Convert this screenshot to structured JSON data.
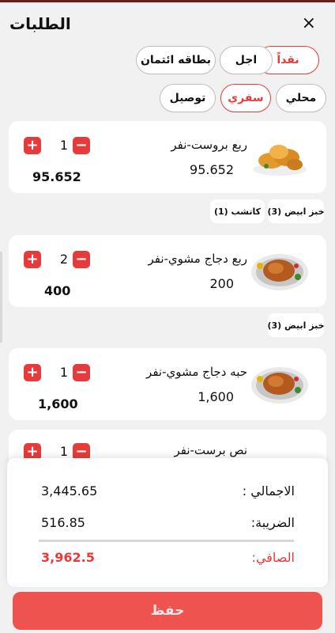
{
  "header": {
    "title": "الطلبات",
    "close_icon": "×"
  },
  "payment_options": [
    {
      "label": "نقداً",
      "active": true
    },
    {
      "label": "اجل",
      "active": false
    },
    {
      "label": "بطاقه ائتمان",
      "active": false
    }
  ],
  "order_types": [
    {
      "label": "محلي",
      "active": false
    },
    {
      "label": "سفري",
      "active": true
    },
    {
      "label": "توصيل",
      "active": false
    }
  ],
  "items": [
    {
      "name": "ربع بروست-نفر",
      "price": "95.652",
      "qty": "1",
      "total": "95.652",
      "image": "broasted-chicken"
    },
    {
      "name": "ربع دجاج مشوي-نفر",
      "price": "200",
      "qty": "2",
      "total": "400",
      "image": "grilled-chicken"
    },
    {
      "name": "حبه دجاج مشوي-نفر",
      "price": "1,600",
      "qty": "1",
      "total": "1,600",
      "image": "grilled-chicken"
    },
    {
      "name": "نص برست-نفر",
      "qty": "1",
      "image": "broasted-chicken"
    }
  ],
  "addons": [
    [
      "خبز ابيض (3)",
      "كاتشب (1)"
    ],
    [
      "خبز ابيض (3)"
    ]
  ],
  "summary": {
    "total_label": "الاجمالي :",
    "total_value": "3,445.65",
    "tax_label": "الضريبة:",
    "tax_value": "516.85",
    "net_label": "الصافي:",
    "net_value": "3,962.5"
  },
  "save_label": "حفظ",
  "colors": {
    "accent": "#e63b3b",
    "save_button": "#ef5350"
  }
}
